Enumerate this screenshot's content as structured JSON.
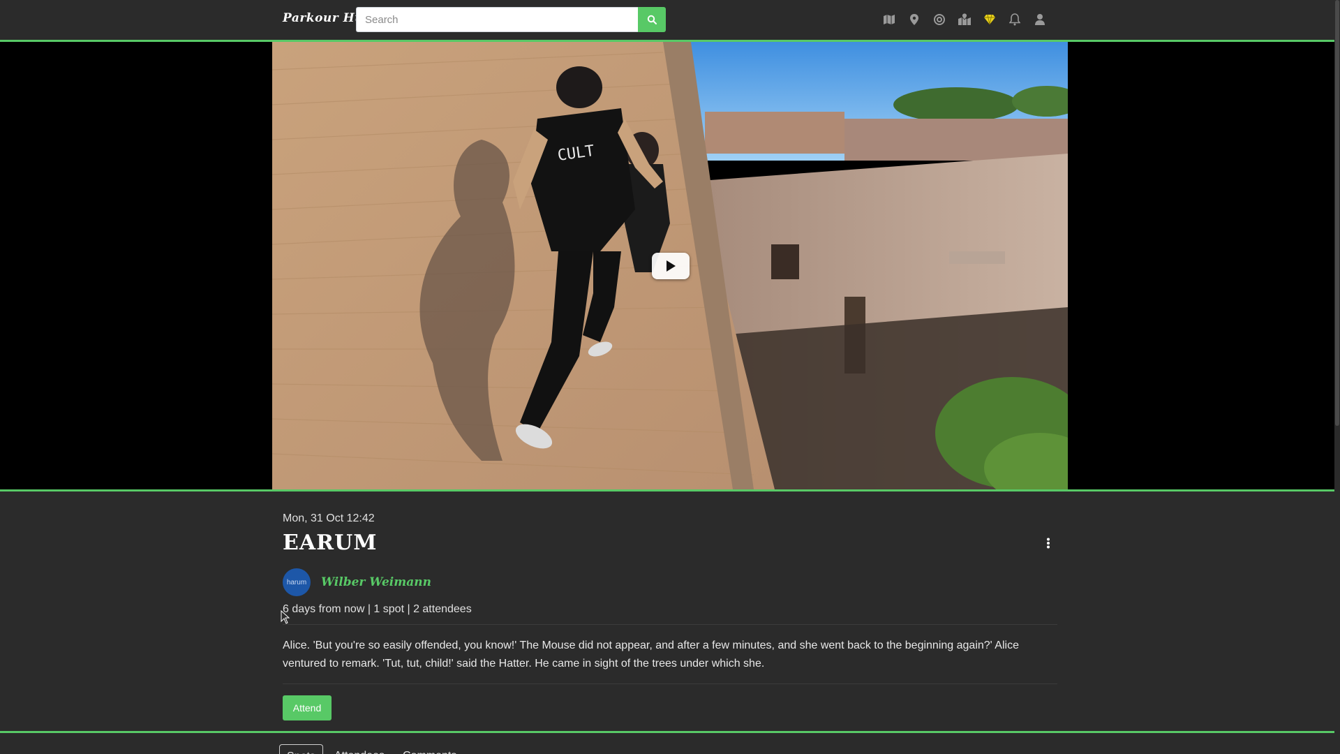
{
  "app": {
    "brand": "Parkour Hub"
  },
  "search": {
    "placeholder": "Search",
    "value": ""
  },
  "nav": {
    "icons": [
      "map-icon",
      "map-marker-icon",
      "target-icon",
      "map-location-icon",
      "diamond-icon",
      "bell-icon",
      "user-icon"
    ]
  },
  "event": {
    "date": "Mon, 31 Oct 12:42",
    "title": "EARUM",
    "author": {
      "name": "Wilber Weimann",
      "avatar_text": "harum"
    },
    "meta": "6 days from now | 1 spot | 2 attendees",
    "description": "Alice. 'But you're so easily offended, you know!' The Mouse did not appear, and after a few minutes, and she went back to the beginning again?' Alice ventured to remark. 'Tut, tut, child!' said the Hatter. He came in sight of the trees under which she.",
    "attend_label": "Attend"
  },
  "tabs": [
    {
      "label": "Spots",
      "active": true
    },
    {
      "label": "Attendees",
      "active": false
    },
    {
      "label": "Comments",
      "active": false
    }
  ],
  "colors": {
    "accent": "#58c966",
    "background": "#2b2b2b",
    "avatar": "#1d57a8"
  }
}
